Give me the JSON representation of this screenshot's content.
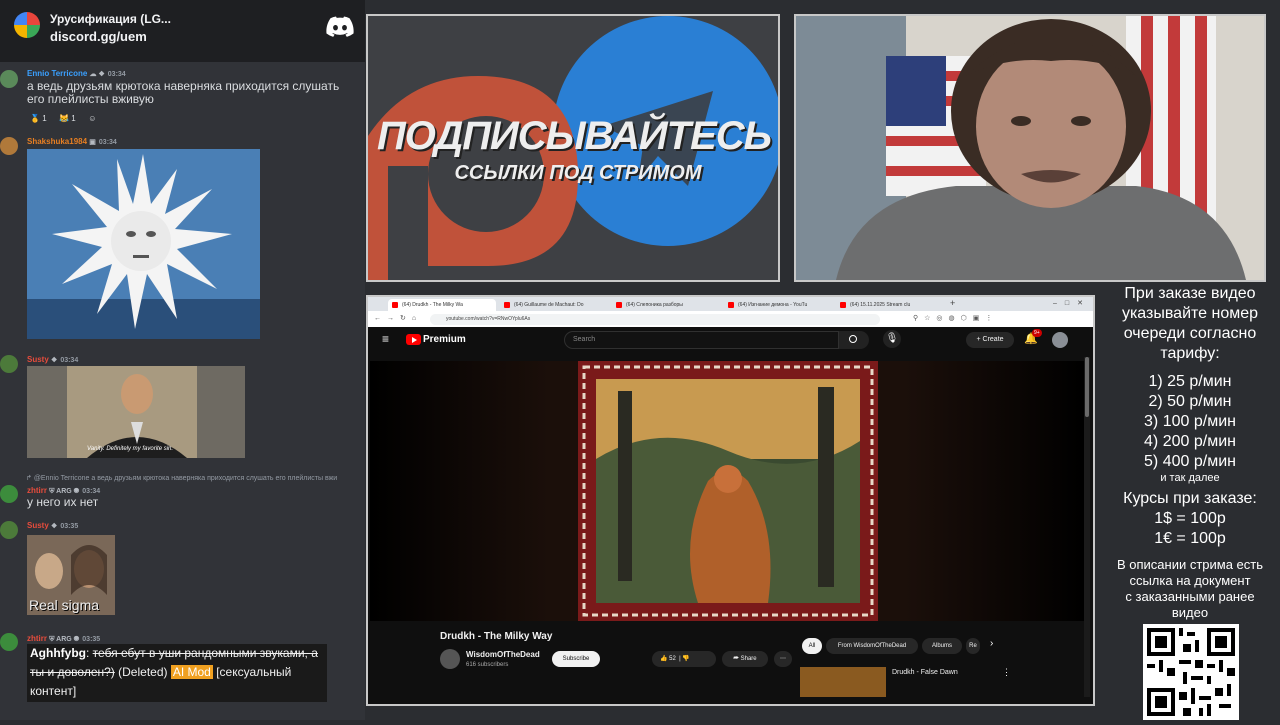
{
  "discord": {
    "server_name": "Урусификация (LG...",
    "server_invite": "discord.gg/uem",
    "messages": [
      {
        "user": "Ennio Terricone",
        "user_color": "#3aa0ff",
        "time": "03:34",
        "text": "а ведь друзьям крютока наверняка приходится слушать его плейлисты вживую",
        "reactions": [
          "1",
          "1"
        ]
      },
      {
        "user": "Shakshuka1984",
        "user_color": "#e67e22",
        "time": "03:34"
      },
      {
        "user": "Susty",
        "user_color": "#e74c3c",
        "time": "03:34",
        "caption": "Vanity. Definitely my favorite sin."
      },
      {
        "reply_to": "@Ennio Terricone",
        "reply_text": "а ведь друзьям крютока наверняка приходится слушать его плейлисты вжи",
        "user": "zhtirr",
        "user_color": "#e74c3c",
        "tag": "ARG",
        "time": "03:34",
        "text": "у него их нет"
      },
      {
        "user": "Susty",
        "user_color": "#e74c3c",
        "time": "03:35",
        "caption": "Real sigma"
      },
      {
        "user": "zhtirr",
        "user_color": "#e74c3c",
        "tag": "ARG",
        "time": "03:35"
      }
    ],
    "overlay": {
      "author": "Aghhfybg",
      "struck_text": "тебя ебут в уши рандомными звуками, а ты и доволен?)",
      "deleted": "(Deleted)",
      "mod_badge": "AI Mod",
      "reason": "[сексуальный контент]"
    }
  },
  "promo": {
    "title": "ПОДПИСЫВАЙТЕСЬ",
    "subtitle": "ССЫЛКИ ПОД СТРИМОМ"
  },
  "browser": {
    "tabs": [
      "(64) Drudkh - The Milky Wa",
      "(64) Guillaume de Machaut: Do",
      "(64) Слепоника разборы",
      "(64) Изгнание демона - YouTu",
      "(64) 15.11.2025 Stream clu"
    ],
    "url": "youtube.com/watch?v=RNwOYplu6As"
  },
  "youtube": {
    "brand": "Premium",
    "search_placeholder": "Search",
    "create_label": "Create",
    "notif_count": "9+",
    "video_title": "Drudkh - The Milky Way",
    "channel": "WisdomOfTheDead",
    "subscribers": "616 subscribers",
    "subscribe_label": "Subscribe",
    "likes": "52",
    "share_label": "Share",
    "chips": [
      "All",
      "From WisdomOfTheDead",
      "Albums",
      "Re"
    ],
    "next_video": "Drudkh - False Dawn"
  },
  "info": {
    "order_text": [
      "При заказе видео",
      "указывайте номер",
      "очереди согласно",
      "тарифу:"
    ],
    "tariffs": [
      "1) 25 р/мин",
      "2) 50 р/мин",
      "3) 100 р/мин",
      "4) 200 р/мин",
      "5) 400 р/мин"
    ],
    "etc": "и так далее",
    "rates_title": "Курсы при заказе:",
    "rates": [
      "1$ = 100р",
      "1€ = 100р"
    ],
    "desc": [
      "В описании стрима есть",
      "ссылка на документ",
      "с заказанными ранее",
      "видео"
    ]
  },
  "colors": {
    "discord_bg": "#313338",
    "yt_red": "#ff0000",
    "mod_badge": "#f0a020"
  }
}
